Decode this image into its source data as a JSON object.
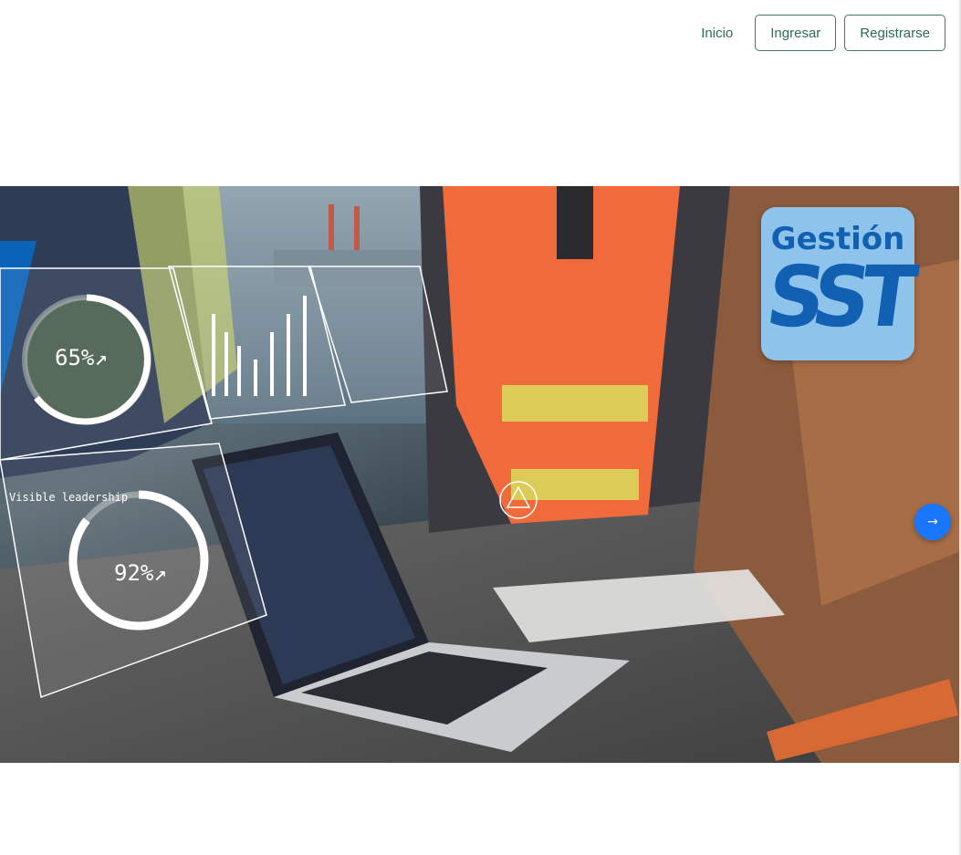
{
  "nav": {
    "home_label": "Inicio",
    "login_label": "Ingresar",
    "register_label": "Registrarse"
  },
  "hero": {
    "overlay_stat_1": "65%↗",
    "overlay_stat_2": "92%↗",
    "overlay_label_2": "Visible leadership",
    "next_icon": "→"
  },
  "logo": {
    "top_text": "Gestión",
    "main_text": "SST"
  },
  "colors": {
    "nav_text": "#2e6b57",
    "carousel_button": "#1976ff",
    "logo_bg": "#8ec3ec",
    "logo_text": "#1160b2",
    "blue_accent": "#0b63b8"
  }
}
